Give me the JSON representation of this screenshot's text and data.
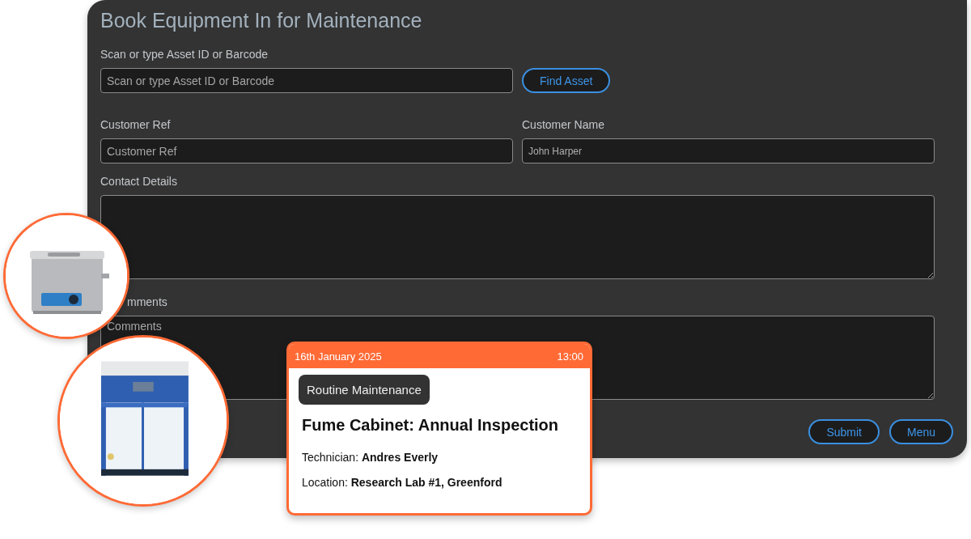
{
  "form": {
    "title": "Book Equipment In for Maintenance",
    "asset": {
      "label": "Scan or type Asset ID or Barcode",
      "placeholder": "Scan or type Asset ID or Barcode",
      "button": "Find Asset"
    },
    "customer_ref": {
      "label": "Customer Ref",
      "placeholder": "Customer Ref"
    },
    "customer_name": {
      "label": "Customer Name",
      "value": "John Harper"
    },
    "contact_details": {
      "label": "Contact Details"
    },
    "comments": {
      "label": "mments",
      "placeholder": "Comments"
    },
    "buttons": [
      "Submit",
      "Menu"
    ]
  },
  "booking_card": {
    "date": "16th January 2025",
    "time": "13:00",
    "tag": "Routine Maintenance",
    "title": "Fume Cabinet: Annual Inspection",
    "details": [
      {
        "label": "Technician:",
        "value": "Andres Everly"
      },
      {
        "label": "Location:",
        "value": "Research Lab #1, Greenford"
      }
    ]
  }
}
